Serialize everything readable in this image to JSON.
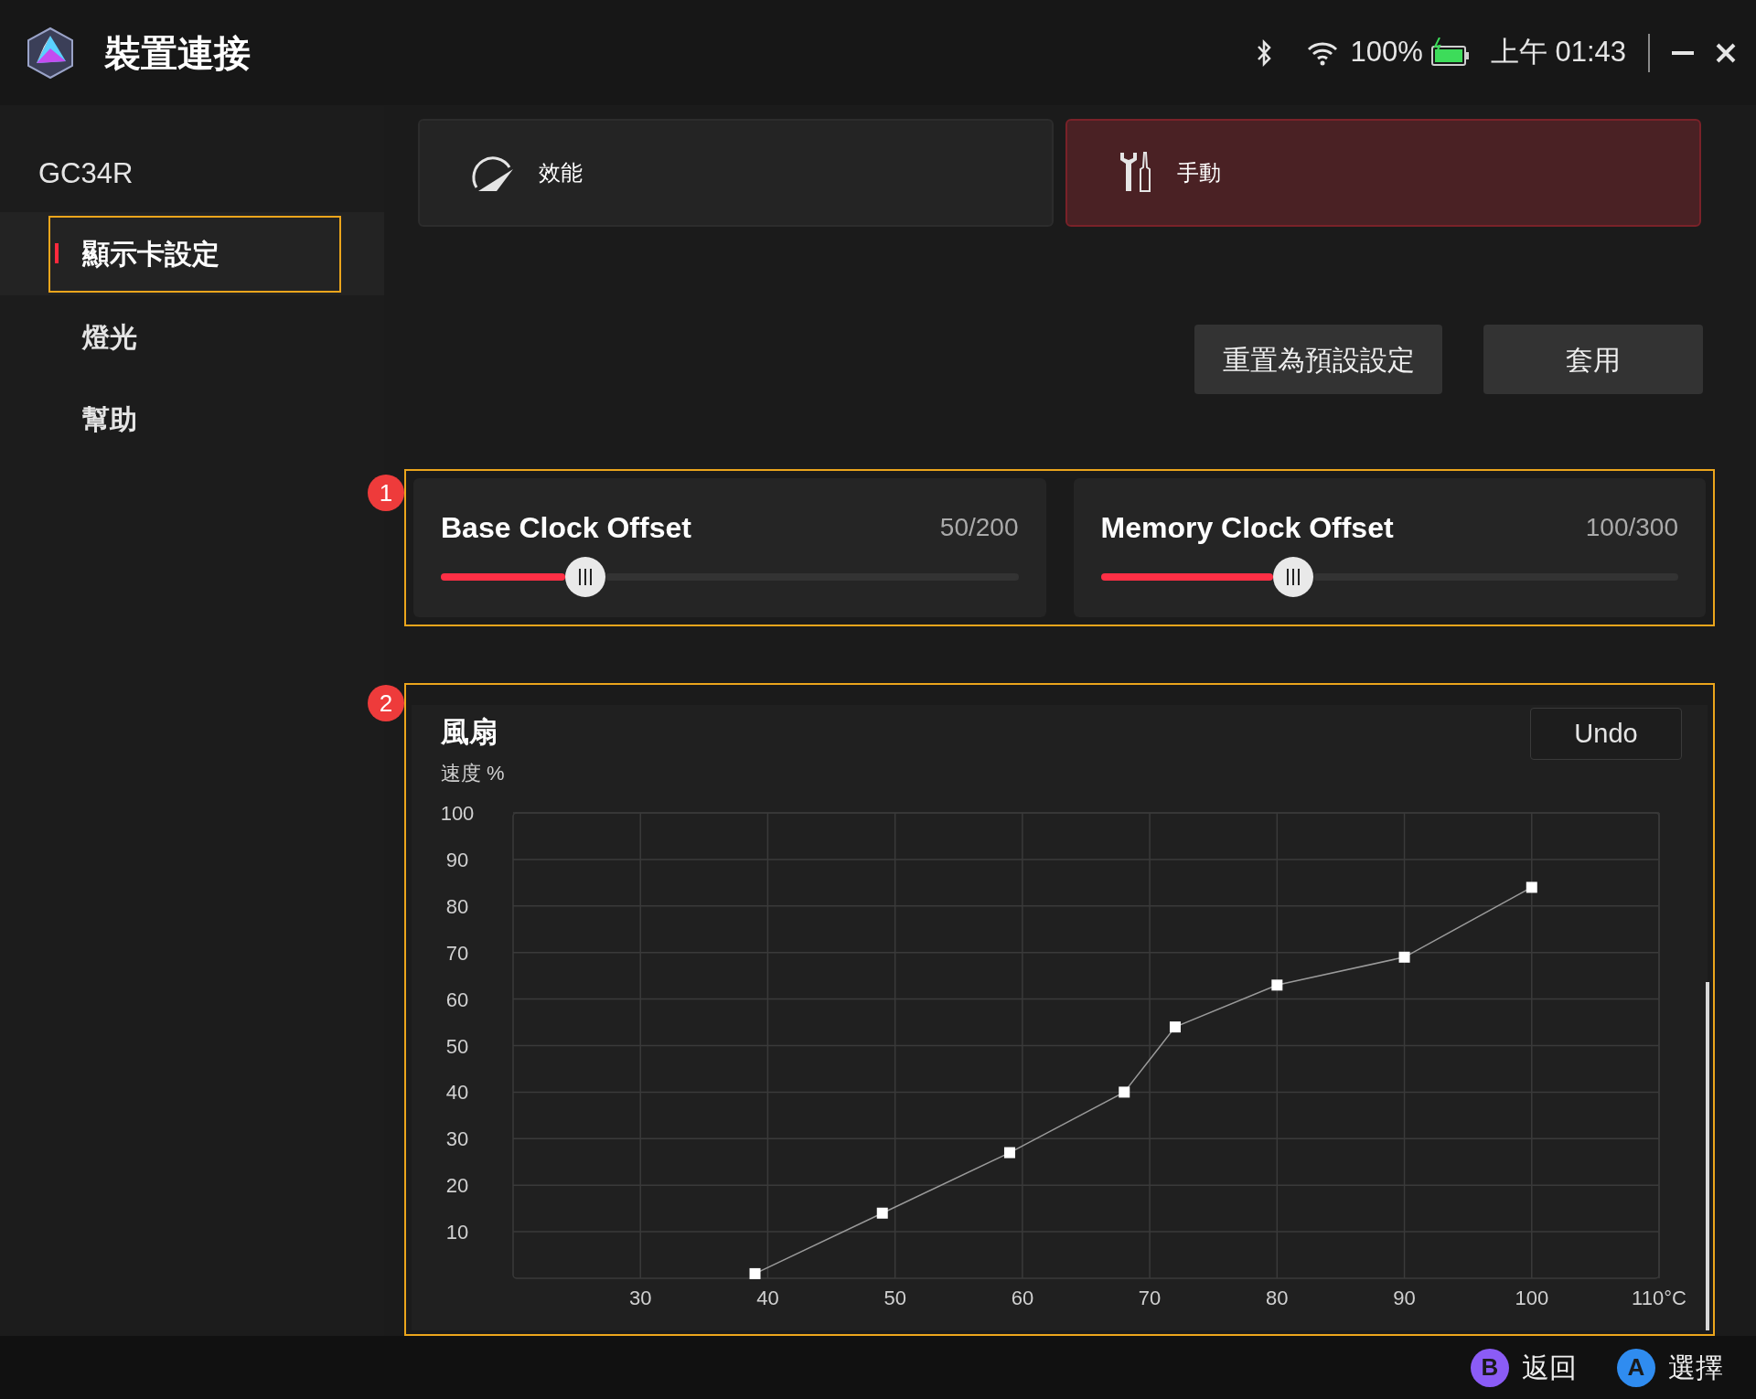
{
  "app": {
    "title": "裝置連接"
  },
  "status": {
    "battery": "100%",
    "time": "上午 01:43"
  },
  "sidebar": {
    "device": "GC34R",
    "items": [
      {
        "label": "顯示卡設定",
        "selected": true
      },
      {
        "label": "燈光",
        "selected": false
      },
      {
        "label": "幫助",
        "selected": false
      }
    ]
  },
  "modes": [
    {
      "kind": "gauge",
      "label": "效能",
      "selected": false
    },
    {
      "kind": "tools",
      "label": "手動",
      "selected": true
    }
  ],
  "actions": [
    "重置為預設設定",
    "套用"
  ],
  "clock_section": {
    "badge": "1",
    "sliders": [
      {
        "label": "Base Clock Offset",
        "reading": "50/200",
        "level": 0.25
      },
      {
        "label": "Memory Clock Offset",
        "reading": "100/300",
        "level": 0.3333
      }
    ]
  },
  "fan": {
    "badge": "2",
    "title": "風扇",
    "undo": "Undo",
    "chart_data": {
      "type": "line",
      "ylabel": "速度 %",
      "x": [
        39,
        49,
        59,
        68,
        72,
        80,
        90,
        100
      ],
      "series": [
        {
          "marker": "square",
          "values": [
            1,
            14,
            27,
            40,
            54,
            63,
            69,
            84
          ]
        }
      ],
      "grid": true,
      "xlim": [
        20,
        110
      ],
      "ylim": [
        0,
        100
      ],
      "xticks": [
        30,
        40,
        50,
        60,
        70,
        80,
        90,
        100,
        {
          "value": 110,
          "label": "110°C"
        }
      ],
      "yticks": [
        10,
        20,
        30,
        40,
        50,
        60,
        70,
        80,
        90,
        100
      ]
    }
  },
  "footer": [
    {
      "key": "B",
      "label": "返回",
      "color": "#8b5cf6"
    },
    {
      "key": "A",
      "label": "選擇",
      "color": "#2f8cf0"
    }
  ]
}
